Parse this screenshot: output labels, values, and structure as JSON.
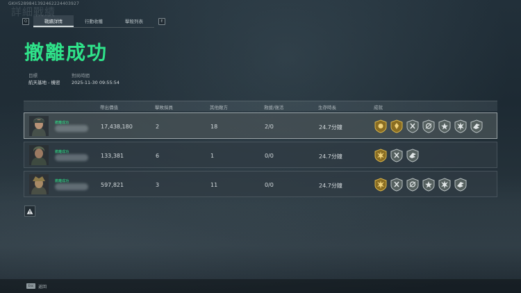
{
  "player_uid": "GKH5289841392462224403927",
  "background_text": "詳細戰績",
  "tabs": [
    {
      "label": "戰績詳情",
      "active": true
    },
    {
      "label": "行動收穫",
      "active": false
    },
    {
      "label": "擊殺列表",
      "active": false
    }
  ],
  "tab_keys": {
    "left": "Q",
    "right": "E"
  },
  "result_title": "撤離成功",
  "info": {
    "target_label": "目標",
    "target_value": "航天基地 - 機密",
    "time_label": "對局時間",
    "time_value": "2025-11-30 09:55:54"
  },
  "columns": [
    "帶出價值",
    "擊敗探員",
    "其他敵方",
    "救援/復活",
    "生存時長",
    "成就"
  ],
  "rows": [
    {
      "status": "撤離成功",
      "value": "17,438,180",
      "kills": "2",
      "others": "18",
      "rescue": "2/0",
      "survival": "24.7分鐘",
      "selected": true,
      "achievements": [
        "gold-skull-badge",
        "gold-shield-badge",
        "silver-cross-badge",
        "silver-target-badge",
        "silver-star-badge",
        "silver-burst-badge",
        "silver-wing-badge"
      ]
    },
    {
      "status": "撤離成功",
      "value": "133,381",
      "kills": "6",
      "others": "1",
      "rescue": "0/0",
      "survival": "24.7分鐘",
      "selected": false,
      "achievements": [
        "gold-burst-badge",
        "silver-cross-badge",
        "silver-wing-badge"
      ]
    },
    {
      "status": "撤離成功",
      "value": "597,821",
      "kills": "3",
      "others": "11",
      "rescue": "0/0",
      "survival": "24.7分鐘",
      "selected": false,
      "achievements": [
        "gold-burst-badge",
        "silver-cross-badge",
        "silver-target-badge",
        "silver-star-badge",
        "silver-burst-badge",
        "silver-wing-badge"
      ]
    }
  ],
  "footer": {
    "key": "Esc",
    "label": "返回"
  },
  "colors": {
    "accent": "#2fe38a",
    "gold": "#c9a13a",
    "silver": "#8e989c"
  }
}
